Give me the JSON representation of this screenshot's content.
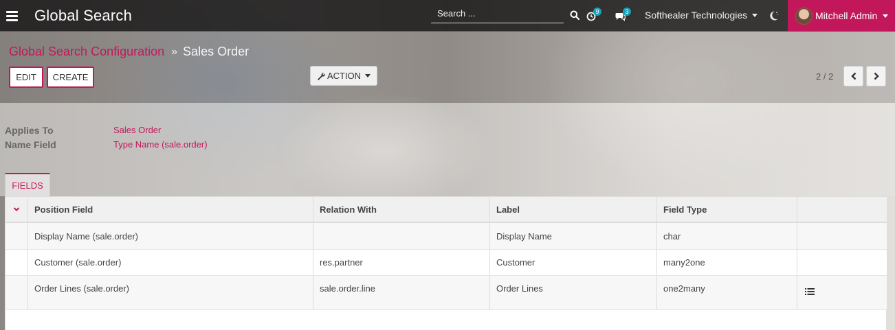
{
  "topbar": {
    "app_title": "Global Search",
    "search_placeholder": "Search ...",
    "activity_count": "9",
    "messages_count": "3",
    "company": "Softhealer Technologies",
    "user": "Mitchell Admin"
  },
  "control_panel": {
    "breadcrumb_parent": "Global Search Configuration",
    "breadcrumb_current": "Sales Order",
    "edit_label": "EDIT",
    "create_label": "CREATE",
    "action_label": "ACTION",
    "pager": "2 / 2"
  },
  "form": {
    "applies_to_label": "Applies To",
    "applies_to_value": "Sales Order",
    "name_field_label": "Name Field",
    "name_field_value": "Type Name (sale.order)",
    "tab_fields": "FIELDS"
  },
  "table": {
    "headers": [
      "Position Field",
      "Relation With",
      "Label",
      "Field Type",
      ""
    ],
    "rows": [
      {
        "position_field": "Display Name (sale.order)",
        "relation_with": "",
        "label": "Display Name",
        "field_type": "char"
      },
      {
        "position_field": "Customer (sale.order)",
        "relation_with": "res.partner",
        "label": "Customer",
        "field_type": "many2one"
      },
      {
        "position_field": "Order Lines (sale.order)",
        "relation_with": "sale.order.line",
        "label": "Order Lines",
        "field_type": "one2many"
      }
    ]
  },
  "colors": {
    "accent": "#c2185b",
    "badge": "#17a2b8",
    "topbar": "#141212"
  }
}
